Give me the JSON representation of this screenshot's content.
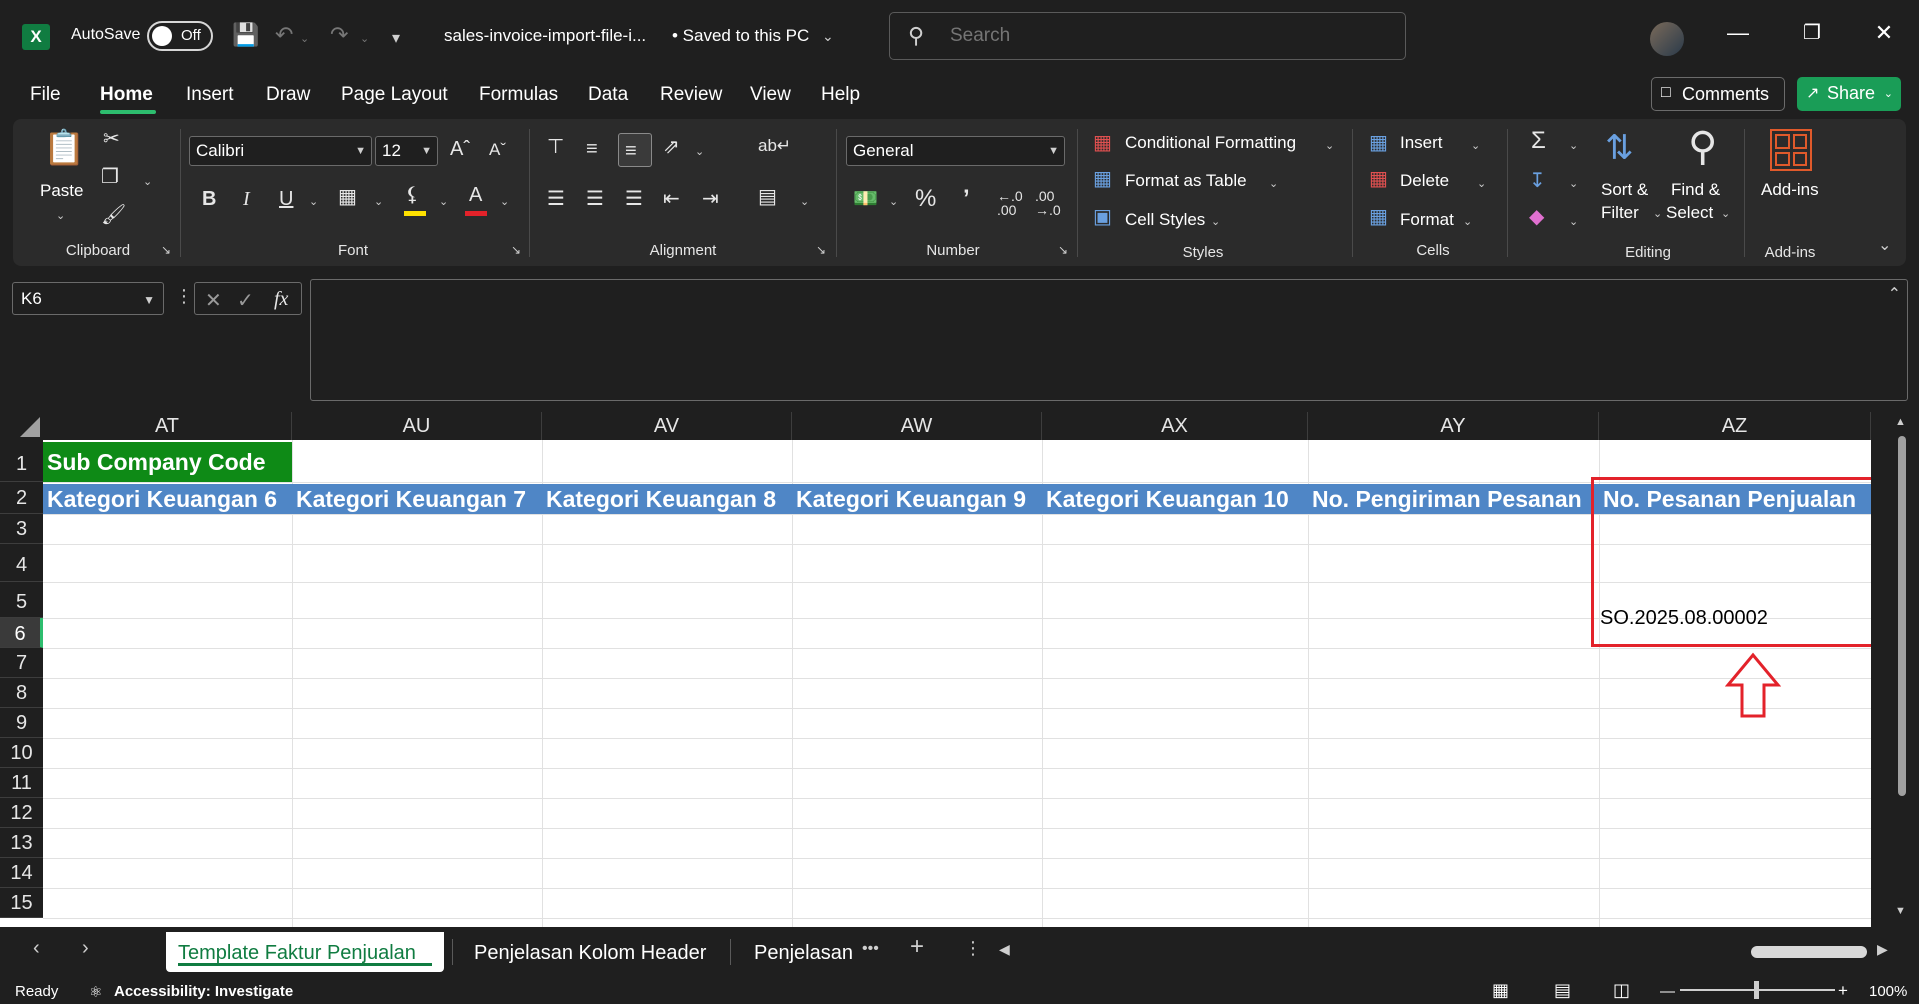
{
  "titlebar": {
    "autosave_label": "AutoSave",
    "autosave_state": "Off",
    "filename": "sales-invoice-import-file-i...",
    "save_status": "• Saved to this PC",
    "search_placeholder": "Search"
  },
  "menu": {
    "tabs": [
      "File",
      "Home",
      "Insert",
      "Draw",
      "Page Layout",
      "Formulas",
      "Data",
      "Review",
      "View",
      "Help"
    ],
    "active": "Home",
    "comments_label": "Comments",
    "share_label": "Share"
  },
  "ribbon": {
    "clipboard": {
      "paste_label": "Paste",
      "group_label": "Clipboard"
    },
    "font": {
      "font_name": "Calibri",
      "font_size": "12",
      "group_label": "Font"
    },
    "alignment": {
      "group_label": "Alignment"
    },
    "number": {
      "format": "General",
      "group_label": "Number"
    },
    "styles": {
      "conditional_formatting": "Conditional Formatting",
      "format_as_table": "Format as Table",
      "cell_styles": "Cell Styles",
      "group_label": "Styles"
    },
    "cells": {
      "insert": "Insert",
      "delete": "Delete",
      "format": "Format",
      "group_label": "Cells"
    },
    "editing": {
      "sort_filter_1": "Sort &",
      "sort_filter_2": "Filter",
      "find_select_1": "Find &",
      "find_select_2": "Select",
      "group_label": "Editing"
    },
    "addins": {
      "label": "Add-ins",
      "group_label": "Add-ins"
    }
  },
  "formula_bar": {
    "name_box": "K6",
    "formula": ""
  },
  "grid": {
    "columns": [
      "AT",
      "AU",
      "AV",
      "AW",
      "AX",
      "AY",
      "AZ"
    ],
    "rows": [
      "1",
      "2",
      "3",
      "4",
      "5",
      "6",
      "7",
      "8",
      "9",
      "10",
      "11",
      "12",
      "13",
      "14",
      "15"
    ],
    "selected_row": "6",
    "row1_AT": "Sub Company Code",
    "row2": [
      "Kategori Keuangan 6",
      "Kategori Keuangan 7",
      "Kategori Keuangan 8",
      "Kategori Keuangan 9",
      "Kategori Keuangan 10",
      "No. Pengiriman Pesanan",
      "No. Pesanan Penjualan"
    ],
    "row5_AZ": "SO.2025.08.00002"
  },
  "sheets": {
    "tabs": [
      "Template Faktur Penjualan",
      "Penjelasan Kolom Header",
      "Penjelasan"
    ],
    "active": "Template Faktur Penjualan",
    "more": "•••",
    "add": "+"
  },
  "status": {
    "ready": "Ready",
    "accessibility": "Accessibility: Investigate",
    "zoom": "100%"
  },
  "colors": {
    "excel_green": "#107c41",
    "header_blue": "#4f86c6",
    "sub_company_green": "#0e8a16",
    "highlight_red": "#e3222a"
  }
}
